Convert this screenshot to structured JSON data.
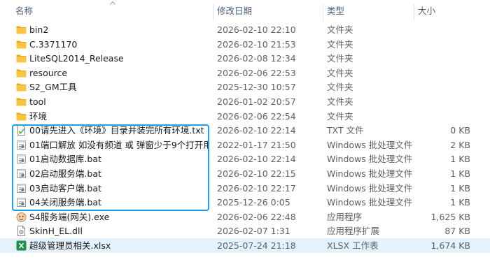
{
  "columns": {
    "name": "名称",
    "date": "修改日期",
    "type": "类型",
    "size": "大小"
  },
  "files": [
    {
      "icon": "folder-icon",
      "name": "bin2",
      "date": "2026-02-10 22:10",
      "type": "文件夹",
      "size": ""
    },
    {
      "icon": "folder-icon",
      "name": "C.3371170",
      "date": "2026-02-10 21:53",
      "type": "文件夹",
      "size": ""
    },
    {
      "icon": "folder-icon",
      "name": "LiteSQL2014_Release",
      "date": "2026-02-08 12:34",
      "type": "文件夹",
      "size": ""
    },
    {
      "icon": "folder-icon",
      "name": "resource",
      "date": "2026-02-06 22:53",
      "type": "文件夹",
      "size": ""
    },
    {
      "icon": "folder-icon",
      "name": "S2_GM工具",
      "date": "2025-12-30 10:57",
      "type": "文件夹",
      "size": ""
    },
    {
      "icon": "folder-icon",
      "name": "tool",
      "date": "2026-01-02 20:57",
      "type": "文件夹",
      "size": ""
    },
    {
      "icon": "folder-icon",
      "name": "环境",
      "date": "2026-02-06 22:54",
      "type": "文件夹",
      "size": ""
    },
    {
      "icon": "text-file-icon",
      "name": "00请先进入《环境》目录并装完所有环境.txt",
      "date": "2026-02-10 22:14",
      "type": "TXT 文件",
      "size": "0 KB"
    },
    {
      "icon": "batch-file-icon",
      "name": "01端口解放 如没有频道 或 弹窗少于9个打开用...",
      "date": "2022-01-17 21:50",
      "type": "Windows 批处理文件",
      "size": "2 KB"
    },
    {
      "icon": "batch-file-icon",
      "name": "01启动数据库.bat",
      "date": "2026-02-10 22:14",
      "type": "Windows 批处理文件",
      "size": "1 KB"
    },
    {
      "icon": "batch-file-icon",
      "name": "02启动服务端.bat",
      "date": "2026-02-10 22:15",
      "type": "Windows 批处理文件",
      "size": "1 KB"
    },
    {
      "icon": "batch-file-icon",
      "name": "03启动客户端.bat",
      "date": "2026-02-10 22:17",
      "type": "Windows 批处理文件",
      "size": "1 KB"
    },
    {
      "icon": "batch-file-icon",
      "name": "04关闭服务端.bat",
      "date": "2025-12-26 0:05",
      "type": "Windows 批处理文件",
      "size": "1 KB"
    },
    {
      "icon": "app-exe-icon",
      "name": "S4服务端(网关).exe",
      "date": "2026-02-06 22:48",
      "type": "应用程序",
      "size": "1,625 KB"
    },
    {
      "icon": "dll-file-icon",
      "name": "SkinH_EL.dll",
      "date": "2026-02-07 1:31",
      "type": "应用程序扩展",
      "size": "87 KB"
    },
    {
      "icon": "excel-file-icon",
      "name": "超级管理员相关.xlsx",
      "date": "2025-07-24 21:18",
      "type": "XLSX 工作表",
      "size": "1,674 KB"
    }
  ],
  "selected_row": "超级管理员相关.xlsx",
  "colors": {
    "highlight_box": "#1e9fe6",
    "selection": "#e5f1fb",
    "folder": "#f7c443",
    "header_text": "#4c607a"
  }
}
